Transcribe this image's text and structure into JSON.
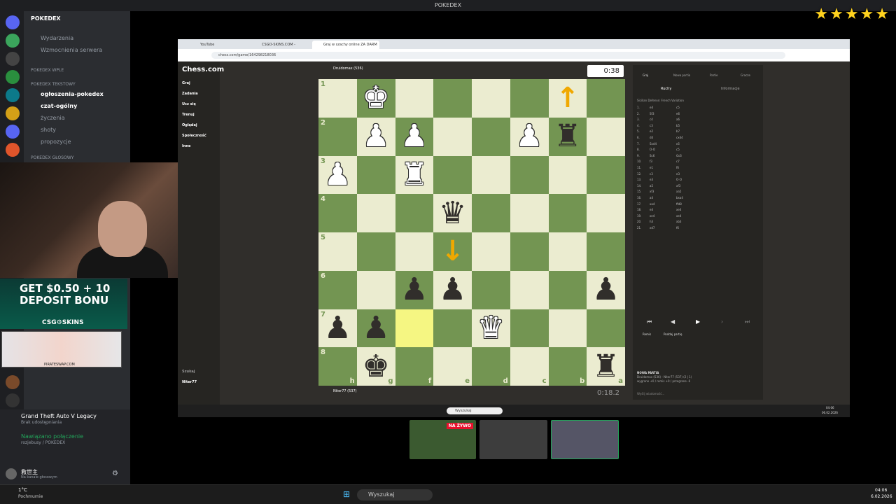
{
  "window_title": "POKEDEX",
  "stars": "★★★★★",
  "discord": {
    "server": "POKEDEX",
    "channels_top": [
      "Wydarzenia",
      "Wzmocnienia serwera"
    ],
    "cat1": "POKEDEX Wple",
    "cat2": "POKEDEX Tekstowy",
    "channels": [
      "ogłoszenia-pokedex",
      "czat-ogólny",
      "życzenia",
      "shoty",
      "propozycje"
    ],
    "cat3": "POKEDEX GŁOSOWY",
    "game": "Grand Theft Auto V Legacy",
    "game_sub": "Brak udostępniania",
    "voice_status": "Nawiązano połączenie",
    "voice_sub": "rozjebusy / POKEDEX",
    "user": "救世主",
    "user_sub": "Na kanale głosowym"
  },
  "ad": {
    "line1": "GET $0.50 + 10",
    "line2": "DEPOSIT BONU",
    "brand": "CSG⚙SKINS",
    "footer": "PIRATESWAP.COM"
  },
  "browser": {
    "tabs": [
      "YouTube",
      "CSGO-SKINS.COM - Najlepsze",
      "Graj w szachy online ZA DARM"
    ],
    "url": "chess.com/game/164298218036"
  },
  "chess_nav": {
    "logo": "Chess.com",
    "items": [
      "Graj",
      "Zadania",
      "Ucz się",
      "Trenuj",
      "Oglądaj",
      "Społeczność",
      "Inne"
    ],
    "search": "Szukaj",
    "user": "Niter77"
  },
  "players": {
    "top": "Druidomax (536)",
    "bottom": "Niter77 (537)",
    "top_clock": "0:38",
    "bottom_clock": "0:18.2"
  },
  "board": {
    "ranks": [
      "1",
      "2",
      "3",
      "4",
      "5",
      "6",
      "7",
      "8"
    ],
    "files": [
      "h",
      "g",
      "f",
      "e",
      "d",
      "c",
      "b",
      "a"
    ],
    "rows": [
      [
        "",
        "♚w",
        "",
        "",
        "",
        "",
        "↑",
        ""
      ],
      [
        "",
        "♟w",
        "♟w",
        "",
        "",
        "♟w",
        "♜b",
        ""
      ],
      [
        "♟w",
        "",
        "♜w",
        "",
        "",
        "",
        "",
        ""
      ],
      [
        "",
        "",
        "",
        "♛b",
        "",
        "",
        "",
        ""
      ],
      [
        "",
        "",
        "",
        "↓",
        "",
        "",
        "",
        ""
      ],
      [
        "",
        "",
        "♟b",
        "♟b",
        "",
        "",
        "",
        "♟b"
      ],
      [
        "♟b",
        "♟b",
        "hl",
        "",
        "♛w",
        "",
        "",
        ""
      ],
      [
        "",
        "♚b",
        "",
        "",
        "",
        "",
        "",
        "♜b"
      ]
    ]
  },
  "panel": {
    "tabs": [
      "Graj",
      "Nowa partia",
      "Partie",
      "Gracze"
    ],
    "subtabs": [
      "Ruchy",
      "Informacje"
    ],
    "opening": "Sicilian Defense: French Variation",
    "moves": [
      [
        "1.",
        "e4",
        "c5"
      ],
      [
        "2.",
        "Sf3",
        "e6"
      ],
      [
        "3.",
        "c4",
        "a6"
      ],
      [
        "4.",
        "c3",
        "b5"
      ],
      [
        "5.",
        "e2",
        "b7"
      ],
      [
        "6.",
        "d4",
        "cxd4"
      ],
      [
        "7.",
        "Sxd4",
        "c6"
      ],
      [
        "8.",
        "O-O",
        "c5"
      ],
      [
        "9.",
        "Sc6",
        "Gc6"
      ],
      [
        "10.",
        "f3",
        "c7"
      ],
      [
        "11.",
        "e1",
        "f6"
      ],
      [
        "12.",
        "c3",
        "e3"
      ],
      [
        "13.",
        "e3",
        "O-O"
      ],
      [
        "14.",
        "a5",
        "xf3"
      ],
      [
        "15.",
        "xf3",
        "xa5"
      ],
      [
        "16.",
        "a4",
        "bxa4"
      ],
      [
        "17.",
        "xa4",
        "ffd8"
      ],
      [
        "18.",
        "e4",
        "xe4"
      ],
      [
        "19.",
        "xe4",
        "xe4"
      ],
      [
        "20.",
        "h3",
        "xb3"
      ],
      [
        "21.",
        "xd7",
        "f6"
      ]
    ],
    "remis": "Remis",
    "resign": "Poddaj partię",
    "new_game": "NOWA PARTIA",
    "summary": "Druidomax (536) - Niter77 (537) (2 | 1)",
    "stats": "wygrane +0 / remis +0 / przegrane -6",
    "chat": "Wyślij wiadomość..."
  },
  "inner_taskbar": {
    "search": "Wyszukaj",
    "time": "04:06",
    "date": "06.02.2026"
  },
  "stream_strip": {
    "live": "NA ŻYWO"
  },
  "taskbar": {
    "weather": "1°C",
    "weather_sub": "Pochmurnie",
    "search": "Wyszukaj",
    "time": "04:06",
    "date": "6.02.2026"
  }
}
